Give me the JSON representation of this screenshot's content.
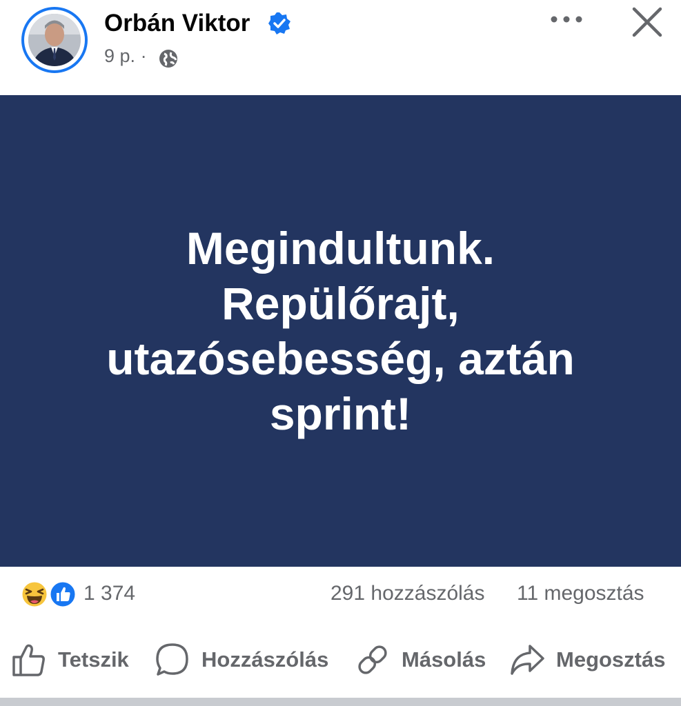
{
  "post": {
    "author": "Orbán Viktor",
    "time": "9 p.",
    "separator": "·",
    "text": "Megindultunk. Repülőrajt, utazósebesség, aztán sprint!",
    "background_color": "#233560",
    "text_color": "#ffffff"
  },
  "stats": {
    "reactions_count": "1 374",
    "comments": "291 hozzászólás",
    "shares": "11 megosztás",
    "reaction_icons": [
      "haha-reaction-icon",
      "like-reaction-icon"
    ]
  },
  "actions": {
    "like": "Tetszik",
    "comment": "Hozzászólás",
    "copy": "Másolás",
    "share": "Megosztás"
  },
  "colors": {
    "accent": "#1877f2",
    "muted_text": "#65676b"
  }
}
